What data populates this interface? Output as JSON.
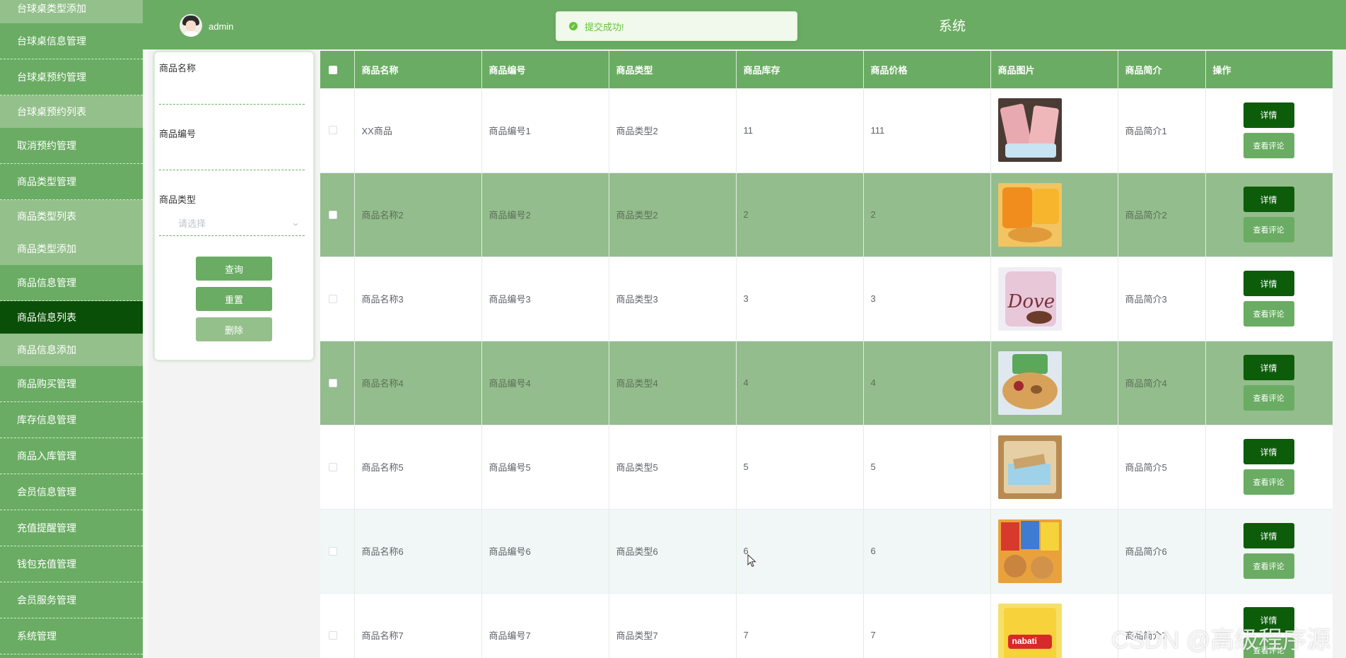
{
  "app": {
    "title_visible": "系统",
    "username": "admin"
  },
  "toast": {
    "message": "提交成功!",
    "icon": "check-circle-icon",
    "color": "#67c23a"
  },
  "colors": {
    "primary": "#6aac63",
    "active": "#0a4f07",
    "sub_bg": "#94c08b",
    "detail_btn": "#0d5c0a",
    "row_highlight": "#93bd8c"
  },
  "sidebar": {
    "items": [
      {
        "label": "台球桌类型添加",
        "type": "sub"
      },
      {
        "label": "台球桌信息管理",
        "type": "menu"
      },
      {
        "label": "台球桌预约管理",
        "type": "menu"
      },
      {
        "label": "台球桌预约列表",
        "type": "sub"
      },
      {
        "label": "取消预约管理",
        "type": "menu"
      },
      {
        "label": "商品类型管理",
        "type": "menu"
      },
      {
        "label": "商品类型列表",
        "type": "sub"
      },
      {
        "label": "商品类型添加",
        "type": "sub"
      },
      {
        "label": "商品信息管理",
        "type": "menu"
      },
      {
        "label": "商品信息列表",
        "type": "active"
      },
      {
        "label": "商品信息添加",
        "type": "sub"
      },
      {
        "label": "商品购买管理",
        "type": "menu"
      },
      {
        "label": "库存信息管理",
        "type": "menu"
      },
      {
        "label": "商品入库管理",
        "type": "menu"
      },
      {
        "label": "会员信息管理",
        "type": "menu"
      },
      {
        "label": "充值提醒管理",
        "type": "menu"
      },
      {
        "label": "钱包充值管理",
        "type": "menu"
      },
      {
        "label": "会员服务管理",
        "type": "menu"
      },
      {
        "label": "系统管理",
        "type": "menu"
      }
    ]
  },
  "search": {
    "name_label": "商品名称",
    "name_value": "",
    "code_label": "商品编号",
    "code_value": "",
    "type_label": "商品类型",
    "type_placeholder": "请选择",
    "query_button": "查询",
    "reset_button": "重置",
    "delete_button": "删除"
  },
  "table": {
    "columns": [
      "商品名称",
      "商品编号",
      "商品类型",
      "商品库存",
      "商品价格",
      "商品图片",
      "商品简介",
      "操作"
    ],
    "detail_label": "详情",
    "review_label": "查看评论",
    "rows": [
      {
        "name": "XX商品",
        "code": "商品编号1",
        "type": "商品类型2",
        "stock": "11",
        "price": "111",
        "intro": "商品简介1",
        "image": "snack-pouch-image",
        "style": "white"
      },
      {
        "name": "商品名称2",
        "code": "商品编号2",
        "type": "商品类型2",
        "stock": "2",
        "price": "2",
        "intro": "商品简介2",
        "image": "chips-bag-image",
        "style": "green"
      },
      {
        "name": "商品名称3",
        "code": "商品编号3",
        "type": "商品类型3",
        "stock": "3",
        "price": "3",
        "intro": "商品简介3",
        "image": "dove-chocolate-image",
        "style": "white"
      },
      {
        "name": "商品名称4",
        "code": "商品编号4",
        "type": "商品类型4",
        "stock": "4",
        "price": "4",
        "intro": "商品简介4",
        "image": "mixed-nuts-image",
        "style": "green"
      },
      {
        "name": "商品名称5",
        "code": "商品编号5",
        "type": "商品类型5",
        "stock": "5",
        "price": "5",
        "intro": "商品简介5",
        "image": "wafer-pack-image",
        "style": "white"
      },
      {
        "name": "商品名称6",
        "code": "商品编号6",
        "type": "商品类型6",
        "stock": "6",
        "price": "6",
        "intro": "商品简介6",
        "image": "snack-assortment-image",
        "style": "light"
      },
      {
        "name": "商品名称7",
        "code": "商品编号7",
        "type": "商品类型7",
        "stock": "7",
        "price": "7",
        "intro": "商品简介7",
        "image": "nabati-box-image",
        "style": "white"
      }
    ]
  },
  "watermark": "CSDN @高级程序源"
}
